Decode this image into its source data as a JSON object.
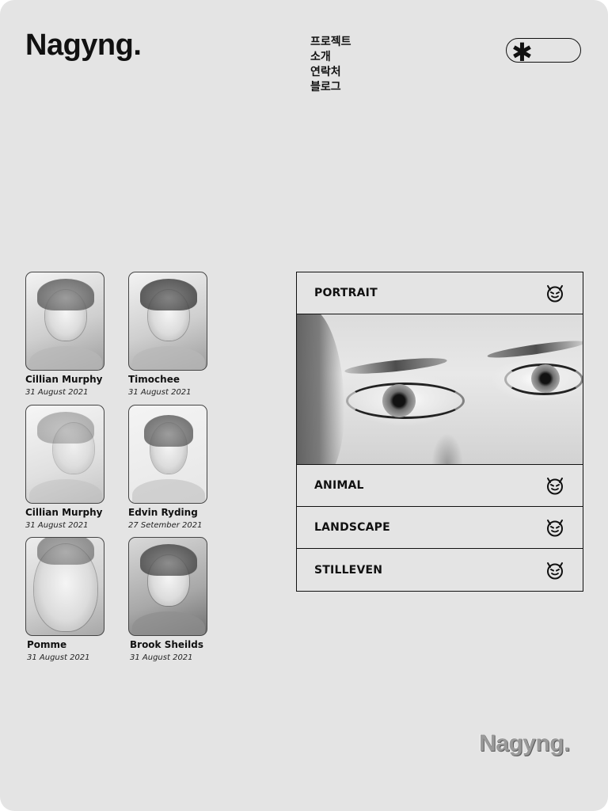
{
  "header": {
    "logo": "Nagyng.",
    "nav": [
      "프로젝트",
      "소개",
      "연락처",
      "블로그"
    ],
    "search_icon": "asterisk-icon"
  },
  "gallery": [
    {
      "name": "Cillian Murphy",
      "date": "31 August 2021"
    },
    {
      "name": "Timochee",
      "date": "31 August 2021"
    },
    {
      "name": "Cillian Murphy",
      "date": "31 August 2021"
    },
    {
      "name": "Edvin Ryding",
      "date": "27 Setember 2021"
    },
    {
      "name": "Pomme",
      "date": "31 August 2021"
    },
    {
      "name": "Brook Sheilds",
      "date": "31 August 2021"
    }
  ],
  "categories": [
    {
      "label": "PORTRAIT",
      "expanded": true,
      "icon": "devil-face-icon"
    },
    {
      "label": "ANIMAL",
      "expanded": false,
      "icon": "devil-face-icon"
    },
    {
      "label": "LANDSCAPE",
      "expanded": false,
      "icon": "devil-face-icon"
    },
    {
      "label": "STILLEVEN",
      "expanded": false,
      "icon": "devil-face-icon"
    }
  ],
  "footer": {
    "logo": "Nagyng."
  },
  "colors": {
    "background": "#e4e4e4",
    "text": "#111111",
    "footer_logo": "#9a9a9a"
  }
}
